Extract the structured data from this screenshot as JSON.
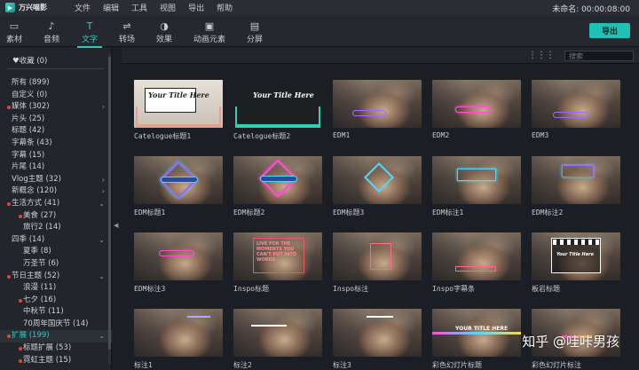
{
  "app": {
    "logo_text": "万兴喵影",
    "project": "未命名: 00:00:08:00"
  },
  "menu": [
    "文件",
    "编辑",
    "工具",
    "视图",
    "导出",
    "帮助"
  ],
  "toolbar": {
    "tabs": [
      {
        "label": "素材",
        "icon": "folder-icon"
      },
      {
        "label": "音频",
        "icon": "music-note-icon"
      },
      {
        "label": "文字",
        "icon": "text-icon"
      },
      {
        "label": "转场",
        "icon": "transition-icon"
      },
      {
        "label": "效果",
        "icon": "effects-icon"
      },
      {
        "label": "动画元素",
        "icon": "image-icon"
      },
      {
        "label": "分屏",
        "icon": "split-screen-icon"
      }
    ],
    "active_tab": "文字",
    "export_label": "导出",
    "accent": "#1fc1b4"
  },
  "sidebar": {
    "favorites": "收藏 (0)",
    "categories": [
      {
        "label": "所有 (899)"
      },
      {
        "label": "自定义 (0)"
      },
      {
        "label": "媒体 (302)",
        "dot": true,
        "chevron": ">"
      },
      {
        "label": "片头 (25)"
      },
      {
        "label": "标题 (42)"
      },
      {
        "label": "字幕条 (43)"
      },
      {
        "label": "字幕 (15)"
      },
      {
        "label": "片尾 (14)"
      },
      {
        "label": "Vlog主题 (32)",
        "chevron": ">"
      },
      {
        "label": "新概念 (120)",
        "chevron": ">"
      },
      {
        "label": "生活方式 (41)",
        "dot": true,
        "chevron": "v"
      },
      {
        "label": "美食 (27)",
        "sub": true,
        "dot": true
      },
      {
        "label": "旅行2 (14)",
        "sub": true
      },
      {
        "label": "四季 (14)",
        "chevron": "v"
      },
      {
        "label": "夏季 (8)",
        "sub": true
      },
      {
        "label": "万圣节 (6)",
        "sub": true
      },
      {
        "label": "节日主题 (52)",
        "dot": true,
        "chevron": "v"
      },
      {
        "label": "浪漫 (11)",
        "sub": true
      },
      {
        "label": "七夕 (16)",
        "sub": true,
        "dot": true
      },
      {
        "label": "中秋节 (11)",
        "sub": true
      },
      {
        "label": "70周年国庆节 (14)",
        "sub": true
      },
      {
        "label": "扩展 (199)",
        "dot": true,
        "chevron": "v",
        "highlight": true
      },
      {
        "label": "标题扩展 (53)",
        "sub": true,
        "dot": true
      },
      {
        "label": "霓虹主题 (15)",
        "sub": true,
        "dot": true
      }
    ]
  },
  "content": {
    "search_placeholder": "搜索",
    "tiles": [
      {
        "caption": "Catelogue标题1",
        "overlay_text": "Your Title Here"
      },
      {
        "caption": "Catelogue标题2",
        "overlay_text": "Your Title Here"
      },
      {
        "caption": "EDM1"
      },
      {
        "caption": "EDM2"
      },
      {
        "caption": "EDM3"
      },
      {
        "caption": "EDM标题1"
      },
      {
        "caption": "EDM标题2"
      },
      {
        "caption": "EDM标题3"
      },
      {
        "caption": "EDM标注1"
      },
      {
        "caption": "EDM标注2"
      },
      {
        "caption": "EDM标注3"
      },
      {
        "caption": "Inspo标题",
        "overlay_text": "LIVE FOR THE MOMENTS YOU CAN'T PUT INTO WORDS"
      },
      {
        "caption": "Inspo标注"
      },
      {
        "caption": "Inspo字幕条"
      },
      {
        "caption": "板岩标题",
        "overlay_text": "Your Title Here"
      },
      {
        "caption": "标注1"
      },
      {
        "caption": "标注2"
      },
      {
        "caption": "标注3"
      },
      {
        "caption": "彩色幻灯片标题",
        "overlay_text": "YOUR TITLE HERE"
      },
      {
        "caption": "彩色幻灯片标注"
      }
    ]
  },
  "watermark": "知乎 @哇咔男孩"
}
